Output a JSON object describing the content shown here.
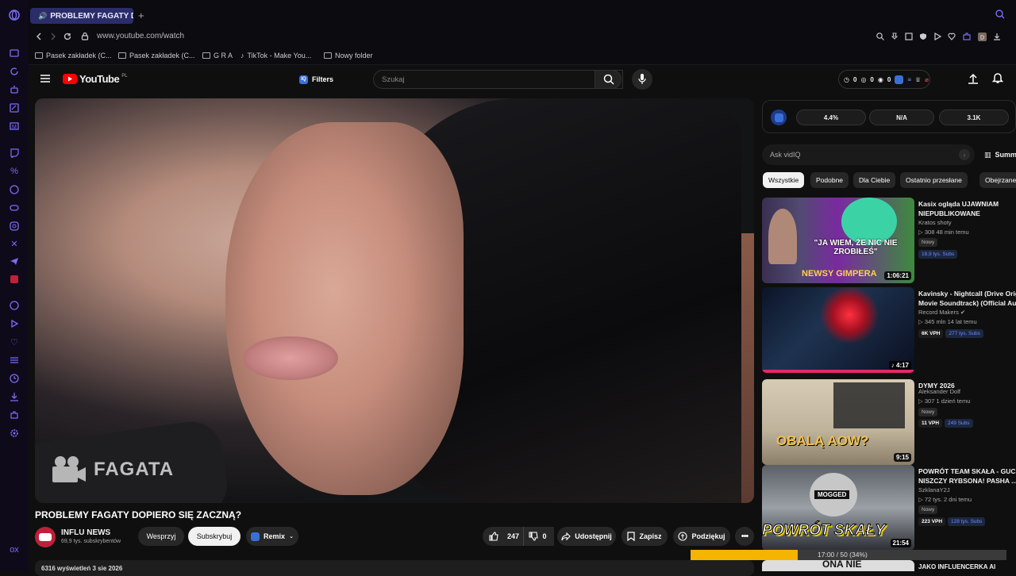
{
  "tab": {
    "title": "PROBLEMY FAGATY DO",
    "add": "+"
  },
  "address": {
    "url": "www.youtube.com/watch"
  },
  "bookmarks": [
    "Pasek zakładek (C...",
    "Pasek zakładek (C...",
    "G R A",
    "TikTok - Make You...",
    "Nowy folder"
  ],
  "yt": {
    "logo": "YouTube",
    "region": "PL",
    "filters": "Filters",
    "iq": "IQ",
    "search_placeholder": "Szukaj",
    "counters": [
      "0",
      "0",
      "0"
    ]
  },
  "video": {
    "watermark": "FAGATA",
    "title": "PROBLEMY FAGATY DOPIERO SIĘ ZACZNĄ?",
    "channel": "INFLU NEWS",
    "subscribers": "69,9 tys. subskrybentów",
    "support_label": "Wesprzyj",
    "subscribe_label": "Subskrybuj",
    "remix_label": "Remix",
    "likes": "247",
    "dislikes": "0",
    "share_label": "Udostępnij",
    "save_label": "Zapisz",
    "thanks_label": "Podziękuj",
    "views_date": "6316 wyświetleń  3 sie 2026"
  },
  "vidiq": {
    "score": "4.4%",
    "na": "N/A",
    "count": "3.1K",
    "ask_placeholder": "Ask vidIQ",
    "summary": "Summ"
  },
  "chips": [
    "Wszystkie",
    "Podobne",
    "Dla Ciebie",
    "Ostatnio przesłane",
    "Obejrzane"
  ],
  "recs": [
    {
      "title": "Kasix ogląda UJAWNIAM NIEPUBLIKOWANE NAGRANIA ...",
      "title2": "",
      "channel": "Kratos shoty",
      "meta": "▷ 308   48 min temu",
      "badge1": "Nowy",
      "badge2": "",
      "subs": "18,9 tys. Subs",
      "duration": "1:06:21",
      "thumb_text": "\"JA WIEM, ŻE NIC NIE ZROBIŁEŚ\"",
      "thumb_text2": "NEWSY GIMPERA"
    },
    {
      "title": "Kavinsky - Nightcall (Drive Origi...",
      "title2": "Movie Soundtrack) (Official Aud...",
      "channel": "Record Makers ✔",
      "meta": "▷ 345 mln   14 lat temu",
      "badge1": "",
      "badge2": "6K VPH",
      "subs": "277 tys. Subs",
      "duration": "♪ 4:17",
      "thumb_text": "",
      "thumb_text2": ""
    },
    {
      "title": "DYMY 2026",
      "title2": "",
      "channel": "Aleksander Dolf",
      "meta": "▷ 307   1 dzień temu",
      "badge1": "Nowy",
      "badge2": "11 VPH",
      "subs": "249 Subs",
      "duration": "9:15",
      "thumb_text": "OBALĄ AOW?",
      "thumb_text2": ""
    },
    {
      "title": "POWRÓT TEAM SKAŁA - GUCIO",
      "title2": "NISZCZY RYBSONA! PASHA ...",
      "channel": "SzklanaY2J",
      "meta": "▷ 72 tys.   2 dni temu",
      "badge1": "Nowy",
      "badge2": "223 VPH",
      "subs": "128 tys. Subs",
      "duration": "21:54",
      "thumb_text": "POWRÓT SKAŁY",
      "thumb_text2": "MOGGED"
    }
  ],
  "next_rec_partial": {
    "title": "JAKO INFLUENCERKA AI",
    "thumb_text": "ONA NIE"
  },
  "progress": {
    "label": "17:00 / 50 (34%)",
    "fraction": 0.34
  },
  "colors": {
    "accent": "#7b6cf6",
    "yt_red": "#ff0000",
    "progress": "#f5b400",
    "vidiq_blue": "#3b6fd8"
  }
}
